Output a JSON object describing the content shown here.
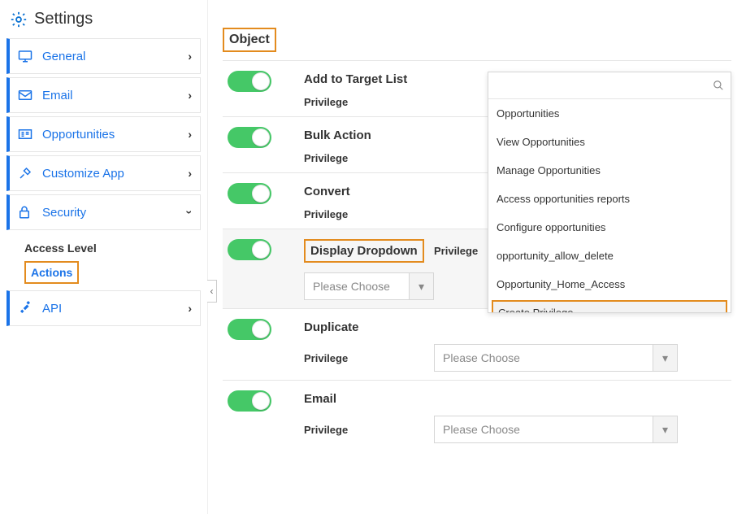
{
  "sidebar": {
    "title": "Settings",
    "items": [
      {
        "label": "General",
        "expanded": false
      },
      {
        "label": "Email",
        "expanded": false
      },
      {
        "label": "Opportunities",
        "expanded": false
      },
      {
        "label": "Customize App",
        "expanded": false
      },
      {
        "label": "Security",
        "expanded": true
      }
    ],
    "access_level_heading": "Access Level",
    "actions_label": "Actions",
    "api_label": "API"
  },
  "section": {
    "heading": "Object"
  },
  "actions": [
    {
      "title": "Add to Target List",
      "on": true,
      "priv_label": "Privilege",
      "selected": ""
    },
    {
      "title": "Bulk Action",
      "on": true,
      "priv_label": "Privilege",
      "selected": ""
    },
    {
      "title": "Convert",
      "on": true,
      "priv_label": "Privilege",
      "selected": ""
    },
    {
      "title": "Display Dropdown",
      "on": true,
      "priv_label": "Privilege",
      "selected": "Please Choose"
    },
    {
      "title": "Duplicate",
      "on": true,
      "priv_label": "Privilege",
      "selected": "Please Choose"
    },
    {
      "title": "Email",
      "on": true,
      "priv_label": "Privilege",
      "selected": "Please Choose"
    }
  ],
  "popup": {
    "search_placeholder": "",
    "options": [
      "Opportunities",
      "View Opportunities",
      "Manage Opportunities",
      "Access opportunities reports",
      "Configure opportunities",
      "opportunity_allow_delete",
      "Opportunity_Home_Access",
      "Create Privilege"
    ]
  }
}
